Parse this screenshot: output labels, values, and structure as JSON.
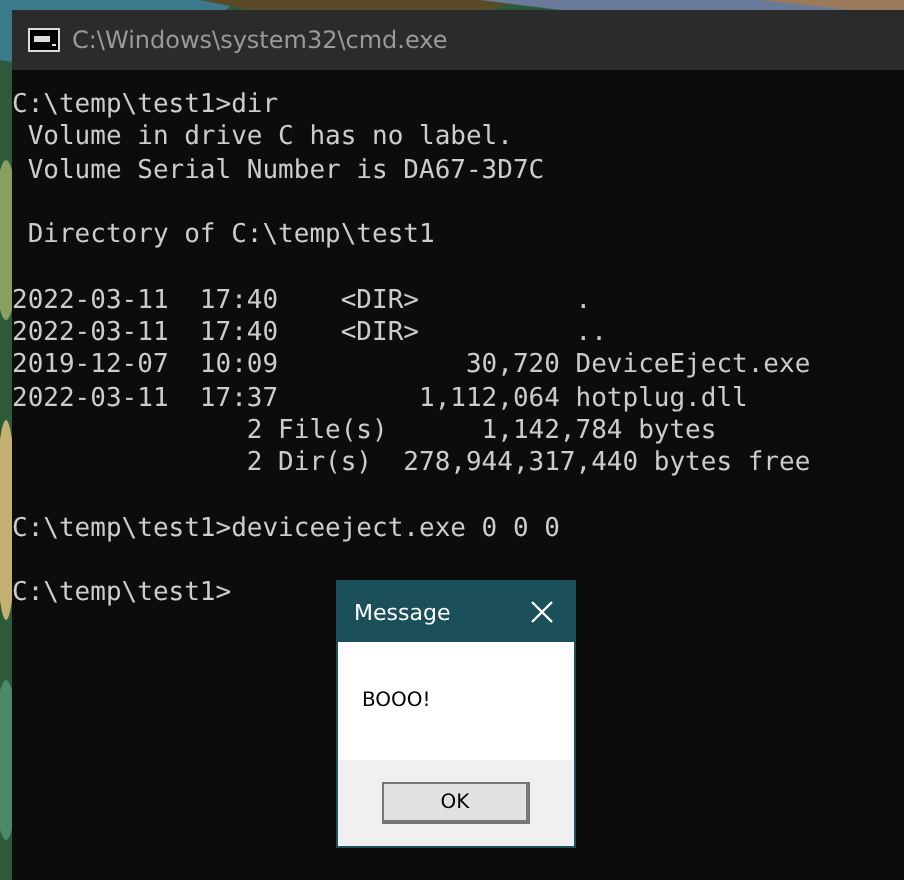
{
  "window": {
    "title": "C:\\Windows\\system32\\cmd.exe"
  },
  "console": {
    "blocks": [
      [
        "C:\\temp\\test1>dir",
        " Volume in drive C has no label.",
        " Volume Serial Number is DA67-3D7C"
      ],
      [
        " Directory of C:\\temp\\test1"
      ],
      [
        "2022-03-11  17:40    <DIR>          .",
        "2022-03-11  17:40    <DIR>          ..",
        "2019-12-07  10:09            30,720 DeviceEject.exe",
        "2022-03-11  17:37         1,112,064 hotplug.dll",
        "               2 File(s)      1,142,784 bytes",
        "               2 Dir(s)  278,944,317,440 bytes free"
      ],
      [
        "C:\\temp\\test1>deviceeject.exe 0 0 0"
      ],
      [
        "C:\\temp\\test1>"
      ]
    ]
  },
  "dialog": {
    "title": "Message",
    "message": "BOOO!",
    "buttons": [
      "OK"
    ]
  }
}
